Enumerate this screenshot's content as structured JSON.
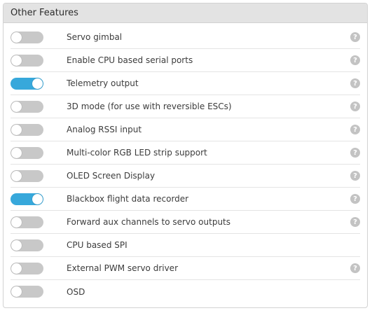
{
  "panel": {
    "title": "Other Features",
    "help_glyph": "?",
    "features": [
      {
        "label": "Servo gimbal",
        "enabled": false,
        "help": true
      },
      {
        "label": "Enable CPU based serial ports",
        "enabled": false,
        "help": true
      },
      {
        "label": "Telemetry output",
        "enabled": true,
        "help": true
      },
      {
        "label": "3D mode (for use with reversible ESCs)",
        "enabled": false,
        "help": true
      },
      {
        "label": "Analog RSSI input",
        "enabled": false,
        "help": true
      },
      {
        "label": "Multi-color RGB LED strip support",
        "enabled": false,
        "help": true
      },
      {
        "label": "OLED Screen Display",
        "enabled": false,
        "help": true
      },
      {
        "label": "Blackbox flight data recorder",
        "enabled": true,
        "help": true
      },
      {
        "label": "Forward aux channels to servo outputs",
        "enabled": false,
        "help": true
      },
      {
        "label": "CPU based SPI",
        "enabled": false,
        "help": false
      },
      {
        "label": "External PWM servo driver",
        "enabled": false,
        "help": true
      },
      {
        "label": "OSD",
        "enabled": false,
        "help": false
      }
    ]
  },
  "colors": {
    "toggle_on": "#37a8db",
    "toggle_off": "#c8c8c8",
    "header_bg": "#e3e3e3"
  }
}
